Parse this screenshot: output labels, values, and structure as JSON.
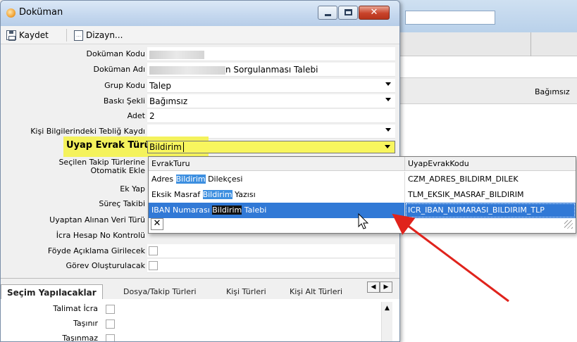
{
  "window": {
    "title": "Doküman",
    "controls": {
      "minimize": "minimize-icon",
      "maximize": "maximize-icon",
      "close": "✕"
    }
  },
  "toolbar": {
    "save_label": "Kaydet",
    "design_label": "Dizayn..."
  },
  "background": {
    "column_value": "Bağımsız"
  },
  "fields": {
    "dokuman_kodu": {
      "label": "Doküman Kodu",
      "value": ""
    },
    "dokuman_adi": {
      "label": "Doküman Adı",
      "value": "n Sorgulanması Talebi"
    },
    "grup_kodu": {
      "label": "Grup Kodu",
      "value": "Talep"
    },
    "baski_sekli": {
      "label": "Baskı Şekli",
      "value": "Bağımsız"
    },
    "adet": {
      "label": "Adet",
      "value": "2"
    },
    "kisi_teblig": {
      "label": "Kişi Bilgilerindeki Tebliğ Kaydı",
      "value": ""
    },
    "uyap_evrak_turu": {
      "label": "Uyap Evrak Türü",
      "value": "Bildirim"
    },
    "secilen_takip": {
      "label": "Seçilen Takip Türlerine"
    },
    "otomatik_ekle": {
      "label": "Otomatik Ekle"
    },
    "ek_yap": {
      "label": "Ek Yap"
    },
    "surec_takibi": {
      "label": "Süreç Takibi"
    },
    "uyaptan_veri": {
      "label": "Uyaptan Alınan Veri Türü"
    },
    "icra_hesap": {
      "label": "İcra Hesap No Kontrolü"
    },
    "foyde_aciklama": {
      "label": "Föyde Açıklama Girilecek",
      "checked": false
    },
    "gorev_olustur": {
      "label": "Görev Oluşturulacak",
      "checked": false
    }
  },
  "dropdown": {
    "columns": [
      "EvrakTuru",
      "UyapEvrakKodu"
    ],
    "rows": [
      {
        "pre": "Adres ",
        "match": "Bildirim",
        "post": " Dilekçesi",
        "code": "CZM_ADRES_BILDIRM_DILEK",
        "selected": false
      },
      {
        "pre": "Eksik Masraf ",
        "match": "Bildirim",
        "post": " Yazısı",
        "code": "TLM_EKSIK_MASRAF_BILDIRIM",
        "selected": false
      },
      {
        "pre": "IBAN Numarası ",
        "match": "Bildirim",
        "post": " Talebi",
        "code": "ICR_IBAN_NUMARASI_BILDIRIM_TLP",
        "selected": true
      }
    ],
    "close_glyph": "✕"
  },
  "tabs": [
    {
      "label": "Seçim Yapılacaklar",
      "active": true
    },
    {
      "label": "Dosya/Takip Türleri",
      "active": false
    },
    {
      "label": "Kişi Türleri",
      "active": false
    },
    {
      "label": "Kişi Alt Türleri",
      "active": false
    }
  ],
  "tab_scroll": {
    "left": "◀",
    "right": "▶"
  },
  "bottom_fields": [
    {
      "label": "Talimat İcra",
      "checked": false
    },
    {
      "label": "Taşınır",
      "checked": false
    },
    {
      "label": "Taşınmaz",
      "checked": false
    }
  ],
  "colors": {
    "highlight": "#f4f25c",
    "selection": "#3179d6",
    "arrow": "#e0231c"
  }
}
